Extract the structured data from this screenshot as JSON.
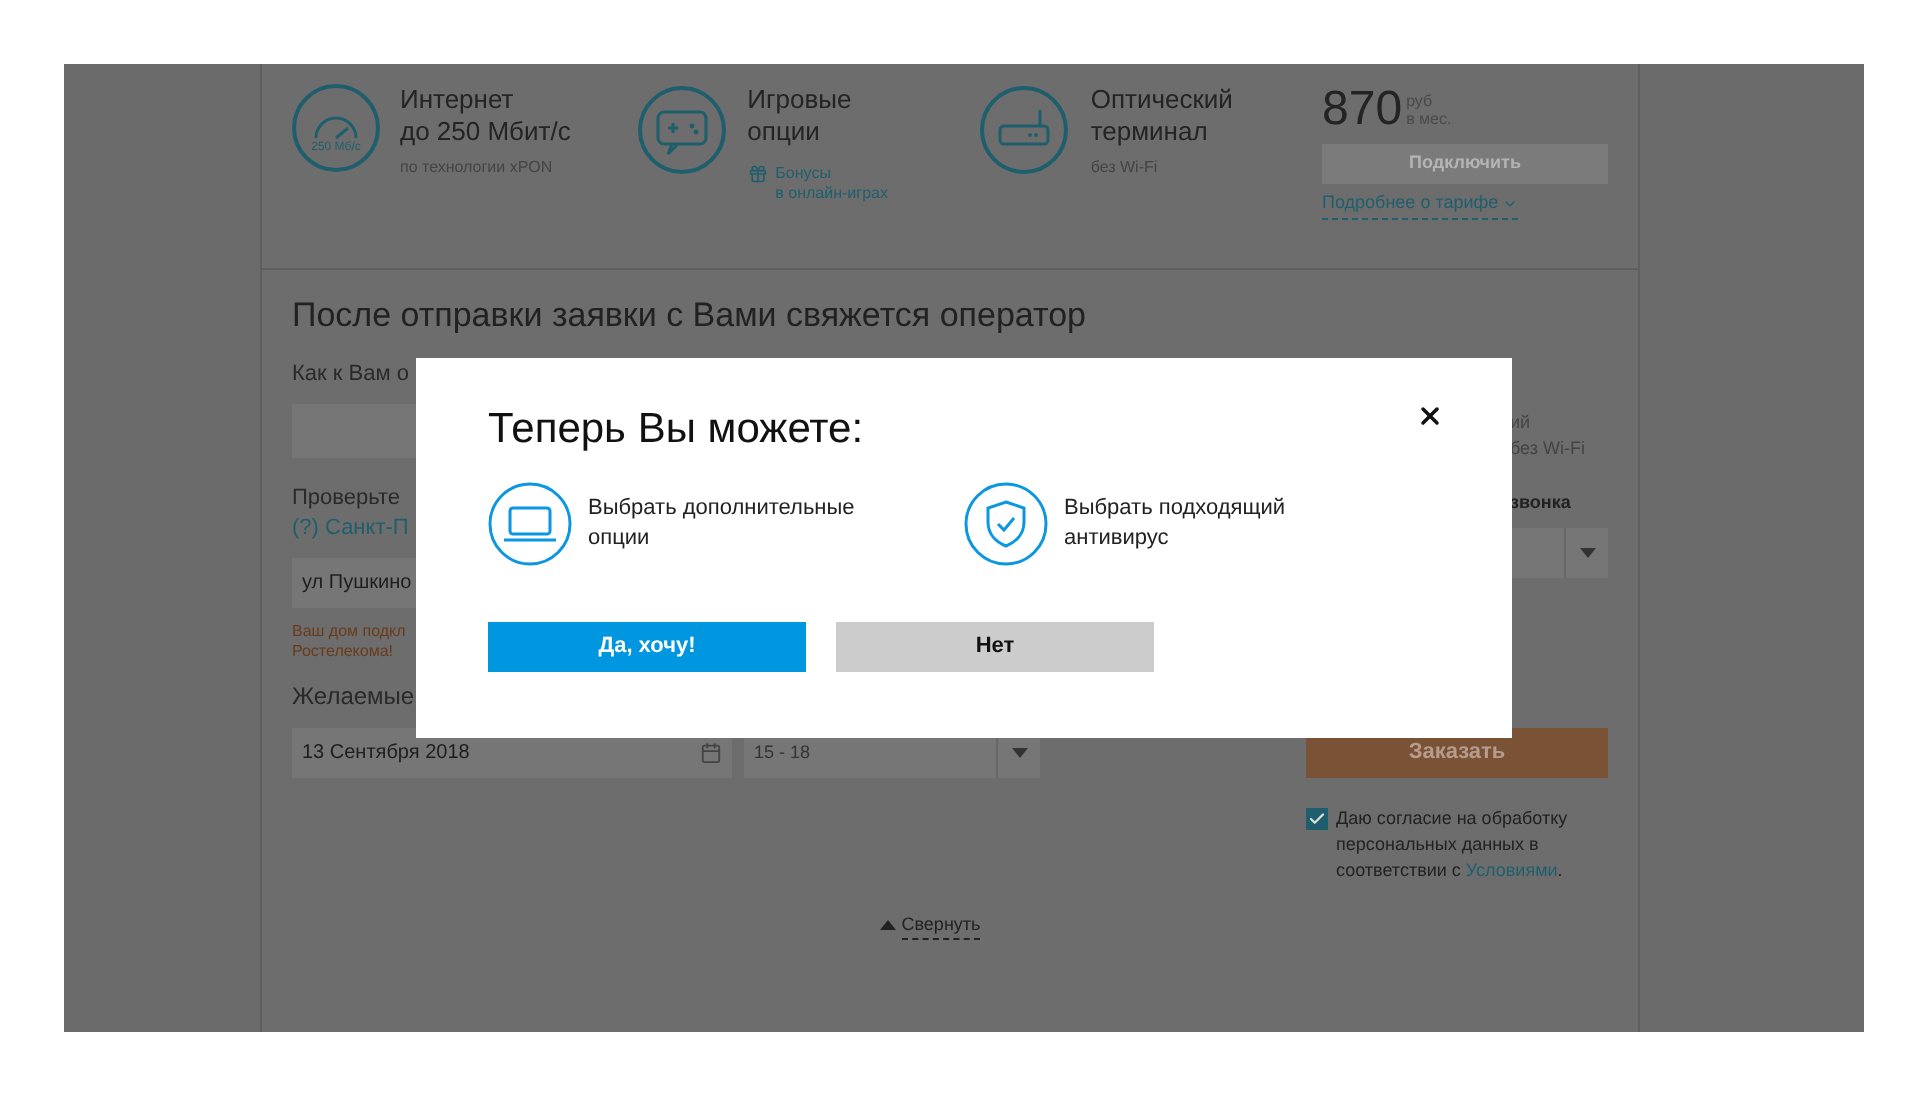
{
  "tariff": {
    "features": [
      {
        "kind": "speed",
        "icon_text": "250 Мб/с",
        "title_lines": [
          "Интернет",
          "до 250 Мбит/с"
        ],
        "note": "по технологии xPON"
      },
      {
        "kind": "games",
        "title_lines": [
          "Игровые",
          "опции"
        ],
        "bonus_lines": [
          "Бонусы",
          "в онлайн-играх"
        ]
      },
      {
        "kind": "router",
        "title_lines": [
          "Оптический",
          "терминал"
        ],
        "note": "без Wi-Fi"
      }
    ],
    "price": "870",
    "currency": "руб",
    "period": "в мес.",
    "connect_button": "Подключить",
    "details_link": "Подробнее о тарифе"
  },
  "form": {
    "heading": "После отправки заявки с Вами свяжется оператор",
    "name_label": "Как к Вам о",
    "address_label": "Проверьте",
    "city_link": "(?) Санкт-П",
    "address_value": "ул Пушкино",
    "notice_lines": [
      "Ваш дом подкл",
      "Ростелекома!"
    ],
    "date_label": "Желаемые",
    "date_value": "13 Сентября 2018",
    "time_value": "15 - 18",
    "right_lines": [
      "ий",
      "без Wi-Fi"
    ],
    "call_label": "звонка",
    "order_button": "Заказать",
    "consent": {
      "checked": true,
      "text": "Даю согласие на обработку персональных данных в соответствии с",
      "link": "Условиями",
      "end": "."
    },
    "collapse_link": "Свернуть"
  },
  "modal": {
    "title": "Теперь Вы можете:",
    "options": [
      {
        "kind": "laptop",
        "text": "Выбрать дополнительные опции"
      },
      {
        "kind": "shield",
        "text": "Выбрать подходящий антивирус"
      }
    ],
    "buttons": [
      {
        "kind": "primary",
        "label": "Да, хочу!"
      },
      {
        "kind": "secondary",
        "label": "Нет"
      }
    ]
  }
}
